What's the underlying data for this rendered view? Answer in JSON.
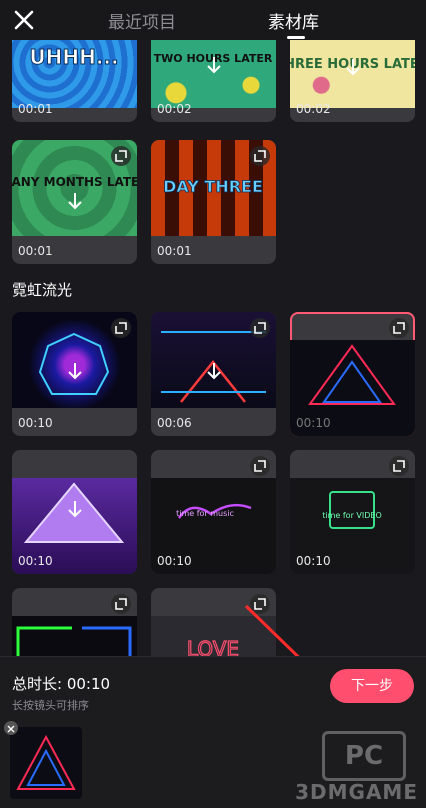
{
  "header": {
    "tab_recent": "最近项目",
    "tab_library": "素材库",
    "active_tab": "素材库"
  },
  "section": {
    "title": "霓虹流光"
  },
  "tiles_top": [
    {
      "caption": "UHHH...",
      "duration": "00:01"
    },
    {
      "caption": "TWO HOURS LATER",
      "duration": "00:02"
    },
    {
      "caption": "THREE HOURS LATER",
      "duration": "00:02"
    },
    {
      "caption": "MANY MONTHS LATER",
      "duration": "00:01"
    },
    {
      "caption": "DAY THREE",
      "duration": "00:01"
    }
  ],
  "tiles_neon": [
    {
      "duration": "00:10",
      "selected": false
    },
    {
      "duration": "00:06",
      "selected": false
    },
    {
      "duration": "00:10",
      "selected": true
    },
    {
      "duration": "00:10",
      "selected": false
    },
    {
      "duration": "00:10",
      "selected": false
    },
    {
      "duration": "00:10",
      "selected": false
    },
    {
      "duration": "",
      "selected": false
    },
    {
      "caption": "LOVE",
      "duration": "",
      "selected": false
    }
  ],
  "neon_signs": {
    "guitar": "time for music",
    "video": "time for VIDEO"
  },
  "bottom": {
    "total_label": "总时长: 00:10",
    "hint": "长按镜头可排序",
    "next_button": "下一步"
  },
  "watermark": {
    "text": "3DMGAME",
    "pc_text": "PC"
  },
  "colors": {
    "accent": "#ff4e6e",
    "background": "#1a1a1e"
  }
}
